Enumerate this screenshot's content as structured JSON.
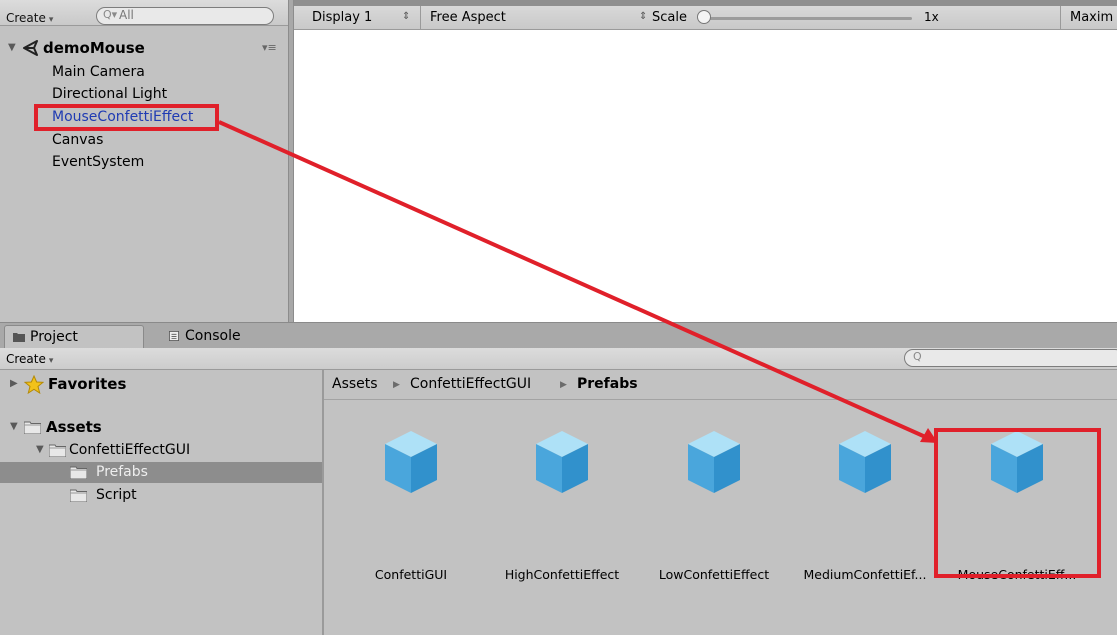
{
  "hierarchy": {
    "create_label": "Create",
    "search_placeholder": "All",
    "scene_name": "demoMouse",
    "items": [
      {
        "label": "Main Camera"
      },
      {
        "label": "Directional Light"
      },
      {
        "label": "MouseConfettiEffect"
      },
      {
        "label": "Canvas"
      },
      {
        "label": "EventSystem"
      }
    ],
    "selected_index": 2
  },
  "game_view": {
    "display": "Display 1",
    "aspect": "Free Aspect",
    "scale_label": "Scale",
    "scale_value": "1x",
    "maximize": "Maxim"
  },
  "project": {
    "tabs": [
      {
        "label": "Project",
        "icon": "folder-icon"
      },
      {
        "label": "Console",
        "icon": "console-icon"
      }
    ],
    "create_label": "Create",
    "tree": {
      "favorites": "Favorites",
      "assets": "Assets",
      "confetti_folder": "ConfettiEffectGUI",
      "prefabs": "Prefabs",
      "script": "Script"
    },
    "breadcrumb": [
      "Assets",
      "ConfettiEffectGUI",
      "Prefabs"
    ],
    "assets": [
      {
        "name": "ConfettiGUI",
        "icon": "prefab-cube-icon"
      },
      {
        "name": "HighConfettiEffect",
        "icon": "prefab-cube-icon"
      },
      {
        "name": "LowConfettiEffect",
        "icon": "prefab-cube-icon"
      },
      {
        "name": "MediumConfettiEf...",
        "icon": "prefab-cube-icon"
      },
      {
        "name": "MouseConfettiEff...",
        "icon": "prefab-cube-icon"
      }
    ]
  },
  "colors": {
    "annotation_red": "#e0202a",
    "selection_blue_text": "#1f3bb3",
    "panel_gray": "#c2c2c2",
    "selected_folder_bg": "#8d8d8d"
  }
}
